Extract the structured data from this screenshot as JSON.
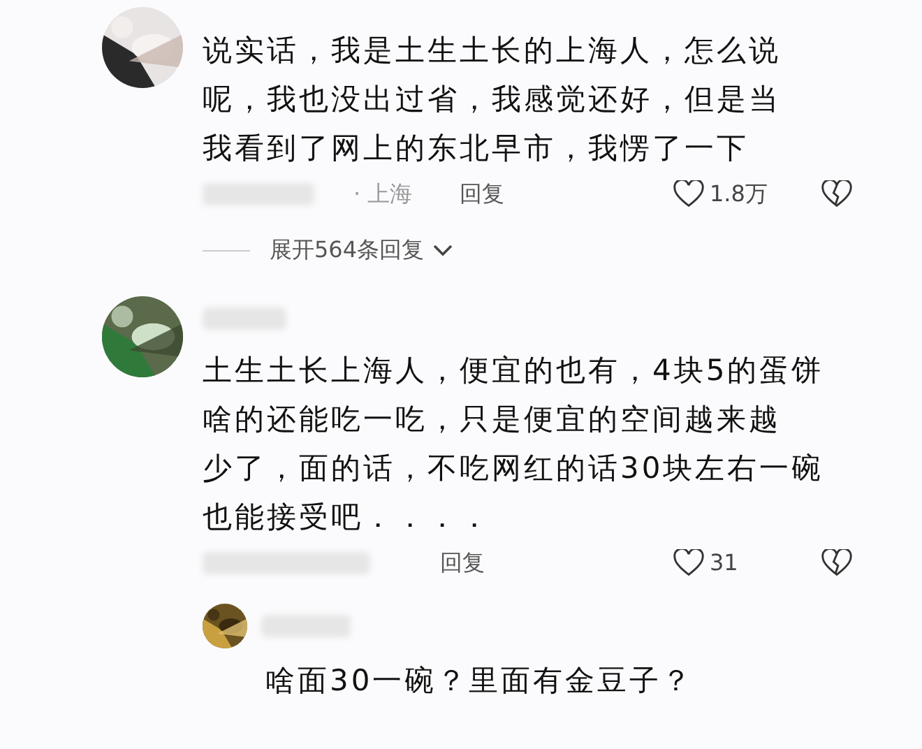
{
  "comments": [
    {
      "lines": [
        "说实话，我是土生土长的上海人，怎么说",
        "呢，我也没出过省，我感觉还好，但是当",
        "我看到了网上的东北早市，我愣了一下"
      ],
      "location": "· 上海",
      "reply_label": "回复",
      "likes": "1.8万",
      "expand": "展开564条回复"
    },
    {
      "lines": [
        "土生土长上海人，便宜的也有，4块5的蛋饼",
        "啥的还能吃一吃，只是便宜的空间越来越",
        "少了，面的话，不吃网红的话30块左右一碗",
        "也能接受吧．．．．"
      ],
      "reply_label": "回复",
      "likes": "31",
      "replies": [
        {
          "text": "啥面30一碗？里面有金豆子？"
        }
      ]
    }
  ]
}
